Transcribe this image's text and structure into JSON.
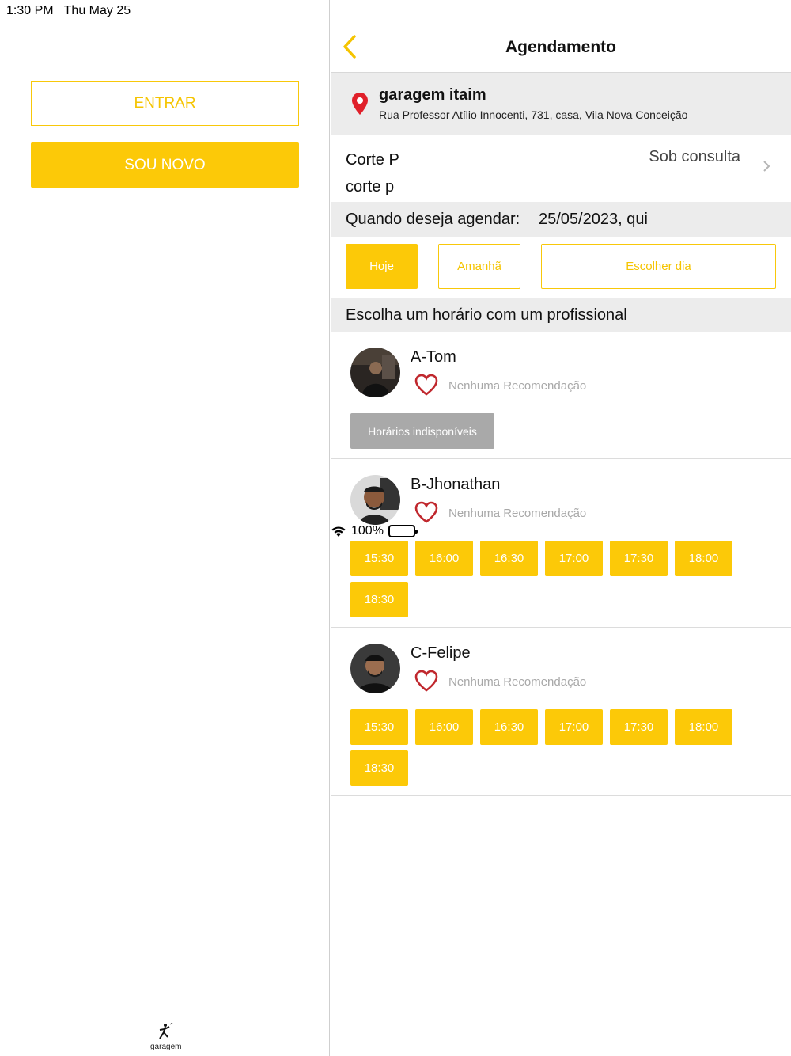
{
  "status_bar": {
    "time": "1:30 PM",
    "date": "Thu May 25",
    "battery": "100%"
  },
  "left": {
    "login_label": "ENTRAR",
    "register_label": "SOU NOVO",
    "logo_text": "garagem"
  },
  "header": {
    "title": "Agendamento"
  },
  "location": {
    "name": "garagem itaim",
    "address": "Rua Professor Atílio Innocenti, 731, casa, Vila Nova Conceição"
  },
  "service": {
    "name": "Corte P",
    "description": "corte p",
    "price": "Sob consulta"
  },
  "schedule": {
    "question": "Quando deseja agendar:",
    "date": "25/05/2023, qui",
    "today_label": "Hoje",
    "tomorrow_label": "Amanhã",
    "choose_day_label": "Escolher dia"
  },
  "section_title": "Escolha um horário com um profissional",
  "professionals": [
    {
      "name": "A-Tom",
      "recommendation": "Nenhuma Recomendação",
      "unavailable_label": "Horários indisponíveis",
      "slots": []
    },
    {
      "name": "B-Jhonathan",
      "recommendation": "Nenhuma Recomendação",
      "slots": [
        "15:30",
        "16:00",
        "16:30",
        "17:00",
        "17:30",
        "18:00",
        "18:30"
      ]
    },
    {
      "name": "C-Felipe",
      "recommendation": "Nenhuma Recomendação",
      "slots": [
        "15:30",
        "16:00",
        "16:30",
        "17:00",
        "17:30",
        "18:00",
        "18:30"
      ]
    }
  ],
  "colors": {
    "accent": "#fcc908",
    "heart": "#c0272d",
    "pin": "#e0202a",
    "section_bg": "#ececec"
  }
}
